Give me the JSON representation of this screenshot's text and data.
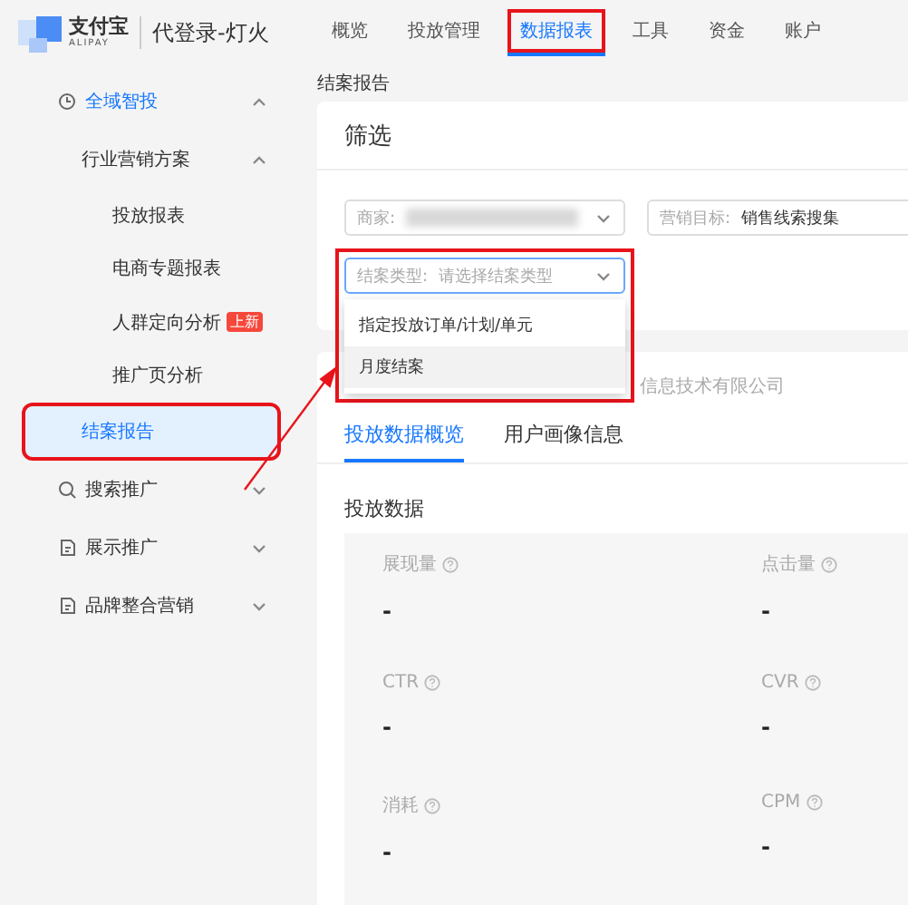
{
  "header": {
    "logo_text": "支付宝",
    "logo_sub": "ALIPAY",
    "account": "代登录-灯火",
    "nav": [
      {
        "label": "概览",
        "selected": false,
        "highlighted": false
      },
      {
        "label": "投放管理",
        "selected": false,
        "highlighted": false
      },
      {
        "label": "数据报表",
        "selected": true,
        "highlighted": true
      },
      {
        "label": "工具",
        "selected": false,
        "highlighted": false
      },
      {
        "label": "资金",
        "selected": false,
        "highlighted": false
      },
      {
        "label": "账户",
        "selected": false,
        "highlighted": false
      }
    ]
  },
  "sidebar": {
    "items": [
      {
        "label": "全域智投",
        "kind": "clock",
        "expanded": true,
        "selected": false,
        "highlighted": false,
        "children": [
          {
            "label": "行业营销方案",
            "expanded": true,
            "selected": false,
            "highlighted": false,
            "children": [
              {
                "label": "投放报表",
                "selected": false,
                "highlighted": false
              },
              {
                "label": "电商专题报表",
                "selected": false,
                "highlighted": false
              },
              {
                "label": "人群定向分析",
                "badge": "上新",
                "selected": false,
                "highlighted": false
              },
              {
                "label": "推广页分析",
                "selected": false,
                "highlighted": false
              }
            ]
          },
          {
            "label": "结案报告",
            "selected": true,
            "highlighted": true
          }
        ]
      },
      {
        "label": "搜索推广",
        "kind": "search",
        "expanded": false,
        "selected": false,
        "highlighted": false
      },
      {
        "label": "展示推广",
        "kind": "doc",
        "expanded": false,
        "selected": false,
        "highlighted": false
      },
      {
        "label": "品牌整合营销",
        "kind": "doc",
        "expanded": false,
        "selected": false,
        "highlighted": false
      }
    ]
  },
  "breadcrumb": "结案报告",
  "filter": {
    "title": "筛选",
    "fields": [
      {
        "label": "商家:",
        "value_redacted": true
      },
      {
        "label": "营销目标:",
        "value": "销售线索搜集"
      }
    ],
    "settlement_field": {
      "label": "结案类型:",
      "placeholder": "请选择结案类型",
      "open": true,
      "highlighted": true,
      "options": [
        {
          "label": "指定投放订单/计划/单元",
          "hovered": false
        },
        {
          "label": "月度结案",
          "hovered": true
        }
      ]
    }
  },
  "report": {
    "company": "信息技术有限公司",
    "tabs": [
      {
        "label": "投放数据概览",
        "selected": true
      },
      {
        "label": "用户画像信息",
        "selected": false
      }
    ],
    "section_title": "投放数据",
    "metrics": [
      {
        "label": "展现量",
        "value": "-"
      },
      {
        "label": "点击量",
        "value": "-"
      },
      {
        "label": "CTR",
        "value": "-"
      },
      {
        "label": "CVR",
        "value": "-"
      },
      {
        "label": "消耗",
        "value": "-"
      },
      {
        "label": "CPM",
        "value": "-"
      }
    ]
  },
  "annotation_arrow": true
}
